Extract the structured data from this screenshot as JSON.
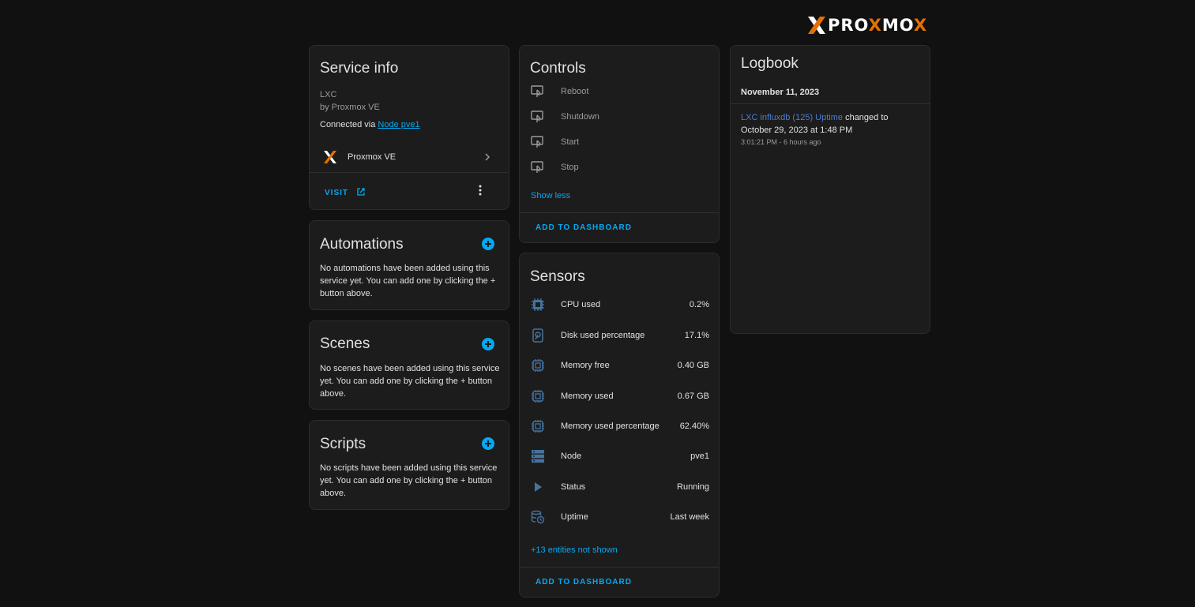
{
  "brand": {
    "logo_text_a": "PRO",
    "logo_text_b": "X",
    "logo_text_c": "MO",
    "logo_text_d": "X",
    "accent": "#e57000"
  },
  "service_info": {
    "title": "Service info",
    "model": "LXC",
    "manufacturer": "by Proxmox VE",
    "connected_prefix": "Connected via ",
    "connected_link": "Node pve1",
    "integration_name": "Proxmox VE",
    "visit_label": "Visit"
  },
  "automations": {
    "title": "Automations",
    "empty_text": "No automations have been added using this service yet. You can add one by clicking the + button above."
  },
  "scenes": {
    "title": "Scenes",
    "empty_text": "No scenes have been added using this service yet. You can add one by clicking the + button above."
  },
  "scripts": {
    "title": "Scripts",
    "empty_text": "No scripts have been added using this service yet. You can add one by clicking the + button above."
  },
  "controls": {
    "title": "Controls",
    "items": [
      {
        "label": "Reboot",
        "icon": "gesture-tap-button-icon"
      },
      {
        "label": "Shutdown",
        "icon": "gesture-tap-button-icon"
      },
      {
        "label": "Start",
        "icon": "gesture-tap-button-icon"
      },
      {
        "label": "Stop",
        "icon": "gesture-tap-button-icon"
      }
    ],
    "show_less": "Show less",
    "add_to_dashboard": "Add to dashboard"
  },
  "sensors": {
    "title": "Sensors",
    "items": [
      {
        "label": "CPU used",
        "value": "0.2%",
        "icon": "cpu-icon"
      },
      {
        "label": "Disk used percentage",
        "value": "17.1%",
        "icon": "harddisk-icon"
      },
      {
        "label": "Memory free",
        "value": "0.40 GB",
        "icon": "memory-icon"
      },
      {
        "label": "Memory used",
        "value": "0.67 GB",
        "icon": "memory-icon"
      },
      {
        "label": "Memory used percentage",
        "value": "62.40%",
        "icon": "memory-icon"
      },
      {
        "label": "Node",
        "value": "pve1",
        "icon": "server-icon"
      },
      {
        "label": "Status",
        "value": "Running",
        "icon": "play-icon"
      },
      {
        "label": "Uptime",
        "value": "Last week",
        "icon": "database-clock-icon"
      }
    ],
    "more_entities": "+13 entities not shown",
    "add_to_dashboard": "Add to dashboard"
  },
  "logbook": {
    "title": "Logbook",
    "date": "November 11, 2023",
    "entry_entity": "LXC influxdb (125) Uptime",
    "entry_message": " changed to",
    "entry_message_2": "October 29, 2023 at 1:48 PM",
    "entry_time": "3:01:21 PM - 6 hours ago"
  },
  "colors": {
    "background": "#111111",
    "card": "#1c1c1c",
    "primary": "#03a9f4",
    "icon": "#44739e"
  }
}
